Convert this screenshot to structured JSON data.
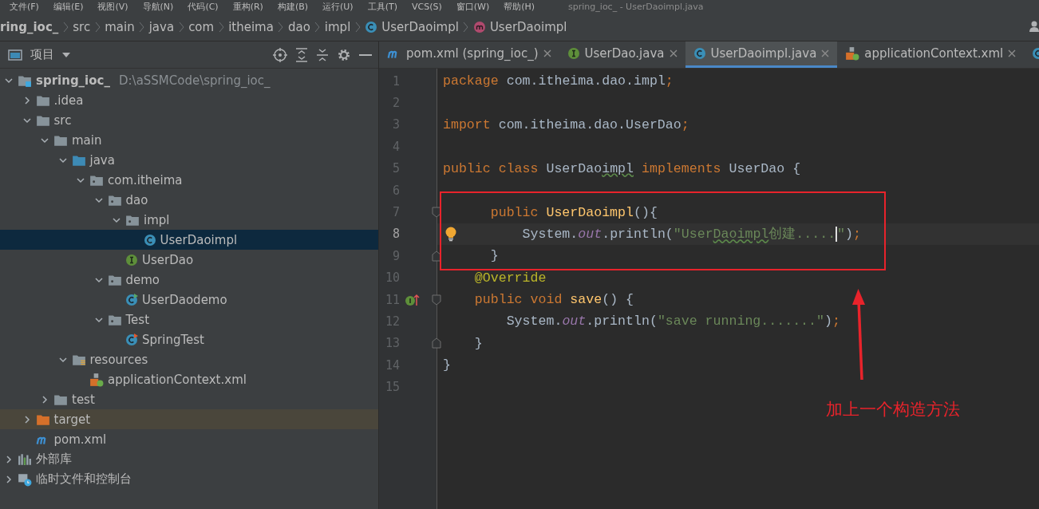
{
  "menu_bar": {
    "items": [
      "文件(F)",
      "编辑(E)",
      "视图(V)",
      "导航(N)",
      "代码(C)",
      "重构(R)",
      "构建(B)",
      "运行(U)",
      "工具(T)",
      "VCS(S)",
      "窗口(W)",
      "帮助(H)"
    ],
    "title": "spring_ioc_ - UserDaoimpl.java"
  },
  "breadcrumbs": [
    {
      "label": "ring_ioc_",
      "kind": "project"
    },
    {
      "label": "src",
      "kind": "folder"
    },
    {
      "label": "main",
      "kind": "folder"
    },
    {
      "label": "java",
      "kind": "folder"
    },
    {
      "label": "com",
      "kind": "folder"
    },
    {
      "label": "itheima",
      "kind": "folder"
    },
    {
      "label": "dao",
      "kind": "folder"
    },
    {
      "label": "impl",
      "kind": "folder"
    },
    {
      "label": "UserDaoimpl",
      "kind": "class"
    },
    {
      "label": "UserDaoimpl",
      "kind": "method"
    }
  ],
  "project_panel": {
    "title": "项目",
    "tree": [
      {
        "label": "spring_ioc_",
        "path": "D:\\aSSMCode\\spring_ioc_",
        "kind": "module",
        "expanded": true,
        "selected": false,
        "excluded": false,
        "children": [
          {
            "label": ".idea",
            "kind": "folder",
            "expanded": false,
            "selected": false,
            "excluded": false
          },
          {
            "label": "src",
            "kind": "folder",
            "expanded": true,
            "selected": false,
            "excluded": false,
            "children": [
              {
                "label": "main",
                "kind": "folder",
                "expanded": true,
                "selected": false,
                "excluded": false,
                "children": [
                  {
                    "label": "java",
                    "kind": "source-folder",
                    "expanded": true,
                    "selected": false,
                    "excluded": false,
                    "children": [
                      {
                        "label": "com.itheima",
                        "kind": "package",
                        "expanded": true,
                        "selected": false,
                        "excluded": false,
                        "children": [
                          {
                            "label": "dao",
                            "kind": "package",
                            "expanded": true,
                            "selected": false,
                            "excluded": false,
                            "children": [
                              {
                                "label": "impl",
                                "kind": "package",
                                "expanded": true,
                                "selected": false,
                                "excluded": false,
                                "children": [
                                  {
                                    "label": "UserDaoimpl",
                                    "kind": "class",
                                    "selected": true,
                                    "excluded": false
                                  }
                                ]
                              },
                              {
                                "label": "UserDao",
                                "kind": "interface",
                                "selected": false,
                                "excluded": false
                              }
                            ]
                          },
                          {
                            "label": "demo",
                            "kind": "package",
                            "expanded": true,
                            "selected": false,
                            "excluded": false,
                            "children": [
                              {
                                "label": "UserDaodemo",
                                "kind": "class-run",
                                "selected": false,
                                "excluded": false
                              }
                            ]
                          },
                          {
                            "label": "Test",
                            "kind": "package",
                            "expanded": true,
                            "selected": false,
                            "excluded": false,
                            "children": [
                              {
                                "label": "SpringTest",
                                "kind": "class-test",
                                "selected": false,
                                "excluded": false
                              }
                            ]
                          }
                        ]
                      }
                    ]
                  },
                  {
                    "label": "resources",
                    "kind": "resources",
                    "expanded": true,
                    "selected": false,
                    "excluded": false,
                    "children": [
                      {
                        "label": "applicationContext.xml",
                        "kind": "spring-xml",
                        "selected": false,
                        "excluded": false
                      }
                    ]
                  }
                ]
              },
              {
                "label": "test",
                "kind": "folder",
                "expanded": false,
                "selected": false,
                "excluded": false
              }
            ]
          },
          {
            "label": "target",
            "kind": "folder-excluded",
            "expanded": false,
            "selected": false,
            "excluded": true
          },
          {
            "label": "pom.xml",
            "kind": "maven",
            "selected": false,
            "excluded": false
          }
        ]
      },
      {
        "label": "外部库",
        "kind": "library",
        "expanded": false,
        "selected": false,
        "excluded": false
      },
      {
        "label": "临时文件和控制台",
        "kind": "scratch",
        "expanded": false,
        "selected": false,
        "excluded": false
      }
    ]
  },
  "tabs": [
    {
      "label": "pom.xml (spring_ioc_)",
      "kind": "maven",
      "selected": false
    },
    {
      "label": "UserDao.java",
      "kind": "interface",
      "selected": false
    },
    {
      "label": "UserDaoimpl.java",
      "kind": "class",
      "selected": true
    },
    {
      "label": "applicationContext.xml",
      "kind": "spring-xml",
      "selected": false
    }
  ],
  "editor": {
    "lines": [
      {
        "number": "1",
        "current": false,
        "tokens": [
          {
            "text": "package",
            "kind": "keyword"
          },
          {
            "text": " com.itheima.dao.impl",
            "kind": "plain"
          },
          {
            "text": ";",
            "kind": "keyword"
          }
        ]
      },
      {
        "number": "2",
        "current": false
      },
      {
        "number": "3",
        "current": false,
        "tokens": [
          {
            "text": "import",
            "kind": "keyword"
          },
          {
            "text": " com.itheima.dao.UserDao",
            "kind": "plain"
          },
          {
            "text": ";",
            "kind": "keyword"
          }
        ]
      },
      {
        "number": "4",
        "current": false
      },
      {
        "number": "5",
        "current": false,
        "tokens": [
          {
            "text": "public class ",
            "kind": "keyword"
          },
          {
            "text": "UserDao",
            "kind": "plain"
          },
          {
            "text": "impl",
            "kind": "typo"
          },
          {
            "text": " implements ",
            "kind": "keyword"
          },
          {
            "text": "UserDao {",
            "kind": "plain"
          }
        ]
      },
      {
        "number": "6",
        "current": false
      },
      {
        "number": "7",
        "current": false,
        "markers": [
          {
            "kind": "fold-start"
          }
        ],
        "tokens": [
          {
            "text": "      public ",
            "kind": "keyword"
          },
          {
            "text": "UserDaoimpl",
            "kind": "declaration"
          },
          {
            "text": "(){",
            "kind": "plain"
          }
        ]
      },
      {
        "number": "8",
        "current": true,
        "markers": [
          {
            "kind": "bulb"
          }
        ],
        "tokens": [
          {
            "text": "          System.",
            "kind": "plain"
          },
          {
            "text": "out",
            "kind": "field"
          },
          {
            "text": ".println(",
            "kind": "plain"
          },
          {
            "text": "\"User",
            "kind": "string"
          },
          {
            "text": "Daoimpl",
            "kind": "string-typo"
          },
          {
            "text": "创建.....",
            "kind": "string"
          },
          {
            "text": "\"",
            "kind": "string-caret"
          },
          {
            "text": ")",
            "kind": "plain"
          },
          {
            "text": ";",
            "kind": "keyword"
          }
        ]
      },
      {
        "number": "9",
        "current": false,
        "markers": [
          {
            "kind": "fold-end"
          }
        ],
        "tokens": [
          {
            "text": "      }",
            "kind": "plain"
          }
        ]
      },
      {
        "number": "10",
        "current": false,
        "tokens": [
          {
            "text": "    @Override",
            "kind": "annotation"
          }
        ]
      },
      {
        "number": "11",
        "current": false,
        "markers": [
          {
            "kind": "implements"
          },
          {
            "kind": "fold-start"
          }
        ],
        "tokens": [
          {
            "text": "    public void ",
            "kind": "keyword"
          },
          {
            "text": "save",
            "kind": "declaration"
          },
          {
            "text": "() {",
            "kind": "plain"
          }
        ]
      },
      {
        "number": "12",
        "current": false,
        "tokens": [
          {
            "text": "        System.",
            "kind": "plain"
          },
          {
            "text": "out",
            "kind": "field"
          },
          {
            "text": ".println(",
            "kind": "plain"
          },
          {
            "text": "\"save running.......\"",
            "kind": "string"
          },
          {
            "text": ")",
            "kind": "plain"
          },
          {
            "text": ";",
            "kind": "keyword"
          }
        ]
      },
      {
        "number": "13",
        "current": false,
        "markers": [
          {
            "kind": "fold-end"
          }
        ],
        "tokens": [
          {
            "text": "    }",
            "kind": "plain"
          }
        ]
      },
      {
        "number": "14",
        "current": false,
        "tokens": [
          {
            "text": "}",
            "kind": "plain"
          }
        ]
      },
      {
        "number": "15",
        "current": false
      }
    ]
  },
  "annotation": {
    "text": "加上一个构造方法"
  }
}
